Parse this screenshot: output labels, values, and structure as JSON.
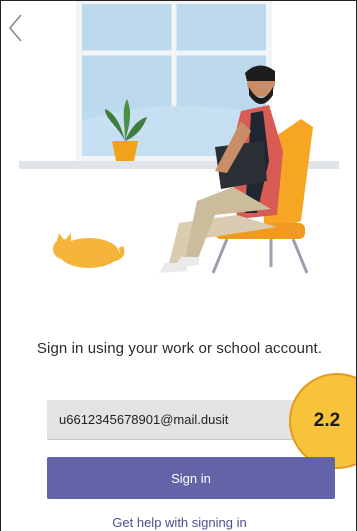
{
  "header": {
    "back_icon": "chevron-left-icon"
  },
  "signin": {
    "prompt": "Sign in using your work or school account.",
    "email_value": "u6612345678901@mail.dusit",
    "button_label": "Sign in",
    "help_link": "Get help with signing in"
  },
  "annotation": {
    "badge_label": "2.2"
  },
  "colors": {
    "accent": "#6264a7",
    "badge_fill": "#f7c33b",
    "badge_border": "#e59a1e",
    "field_background": "#e3e3e3"
  }
}
